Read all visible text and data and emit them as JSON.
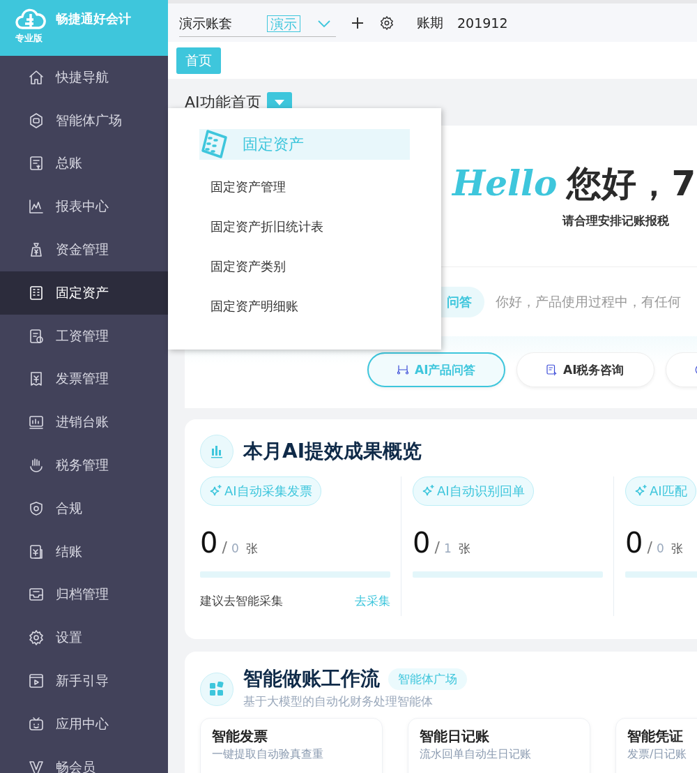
{
  "app": {
    "name": "畅捷通好会计",
    "edition": "专业版"
  },
  "topbar": {
    "account_set": "演示账套",
    "account_tag": "演示",
    "period_label": "账期",
    "period": "201912"
  },
  "tabs": [
    {
      "label": "首页",
      "selected": true
    }
  ],
  "sidebar": {
    "items": [
      {
        "label": "快捷导航",
        "selected": false
      },
      {
        "label": "智能体广场",
        "selected": false
      },
      {
        "label": "总账",
        "selected": false
      },
      {
        "label": "报表中心",
        "selected": false
      },
      {
        "label": "资金管理",
        "selected": false
      },
      {
        "label": "固定资产",
        "selected": true
      },
      {
        "label": "工资管理",
        "selected": false
      },
      {
        "label": "发票管理",
        "selected": false
      },
      {
        "label": "进销台账",
        "selected": false
      },
      {
        "label": "税务管理",
        "selected": false
      },
      {
        "label": "合规",
        "selected": false
      },
      {
        "label": "结账",
        "selected": false
      },
      {
        "label": "归档管理",
        "selected": false
      },
      {
        "label": "设置",
        "selected": false
      },
      {
        "label": "新手引导",
        "selected": false
      },
      {
        "label": "应用中心",
        "selected": false
      },
      {
        "label": "畅会员",
        "selected": false
      }
    ]
  },
  "page_title": "AI功能首页",
  "flyout_menu": {
    "title": "固定资产",
    "items": [
      "固定资产管理",
      "固定资产折旧统计表",
      "固定资产类别",
      "固定资产明细账"
    ]
  },
  "greeting": {
    "hello": "Hello",
    "text": "您好，7",
    "subtitle": "请合理安排记账报税"
  },
  "assistant": {
    "tag": "问答",
    "prompt": "你好，产品使用过程中，有任何"
  },
  "quick_actions": [
    {
      "label": "AI产品问答",
      "selected": true
    },
    {
      "label": "AI税务咨询",
      "selected": false
    },
    {
      "selected": false
    }
  ],
  "overview": {
    "title": "本月AI提效成果概览",
    "metrics": [
      {
        "tag": "AI自动采集发票",
        "value": "0",
        "separator": "/",
        "total": "0",
        "unit": "张",
        "level": 0,
        "hint": "建议去智能采集",
        "link": "去采集"
      },
      {
        "tag": "AI自动识别回单",
        "value": "0",
        "separator": "/",
        "total": "1",
        "unit": "张",
        "level": 0
      },
      {
        "tag": "AI匹配",
        "value": "0",
        "separator": "/",
        "total": "0",
        "unit": "张",
        "level": 0
      }
    ]
  },
  "workflow": {
    "title": "智能做账工作流",
    "badge": "智能体广场",
    "subtitle": "基于大模型的自动化财务处理智能体",
    "cards": [
      {
        "title": "智能发票",
        "desc": "一键提取自动验真查重"
      },
      {
        "title": "智能日记账",
        "desc": "流水回单自动生日记账"
      },
      {
        "title": "智能凭证",
        "desc": "发票/日记账"
      }
    ]
  }
}
